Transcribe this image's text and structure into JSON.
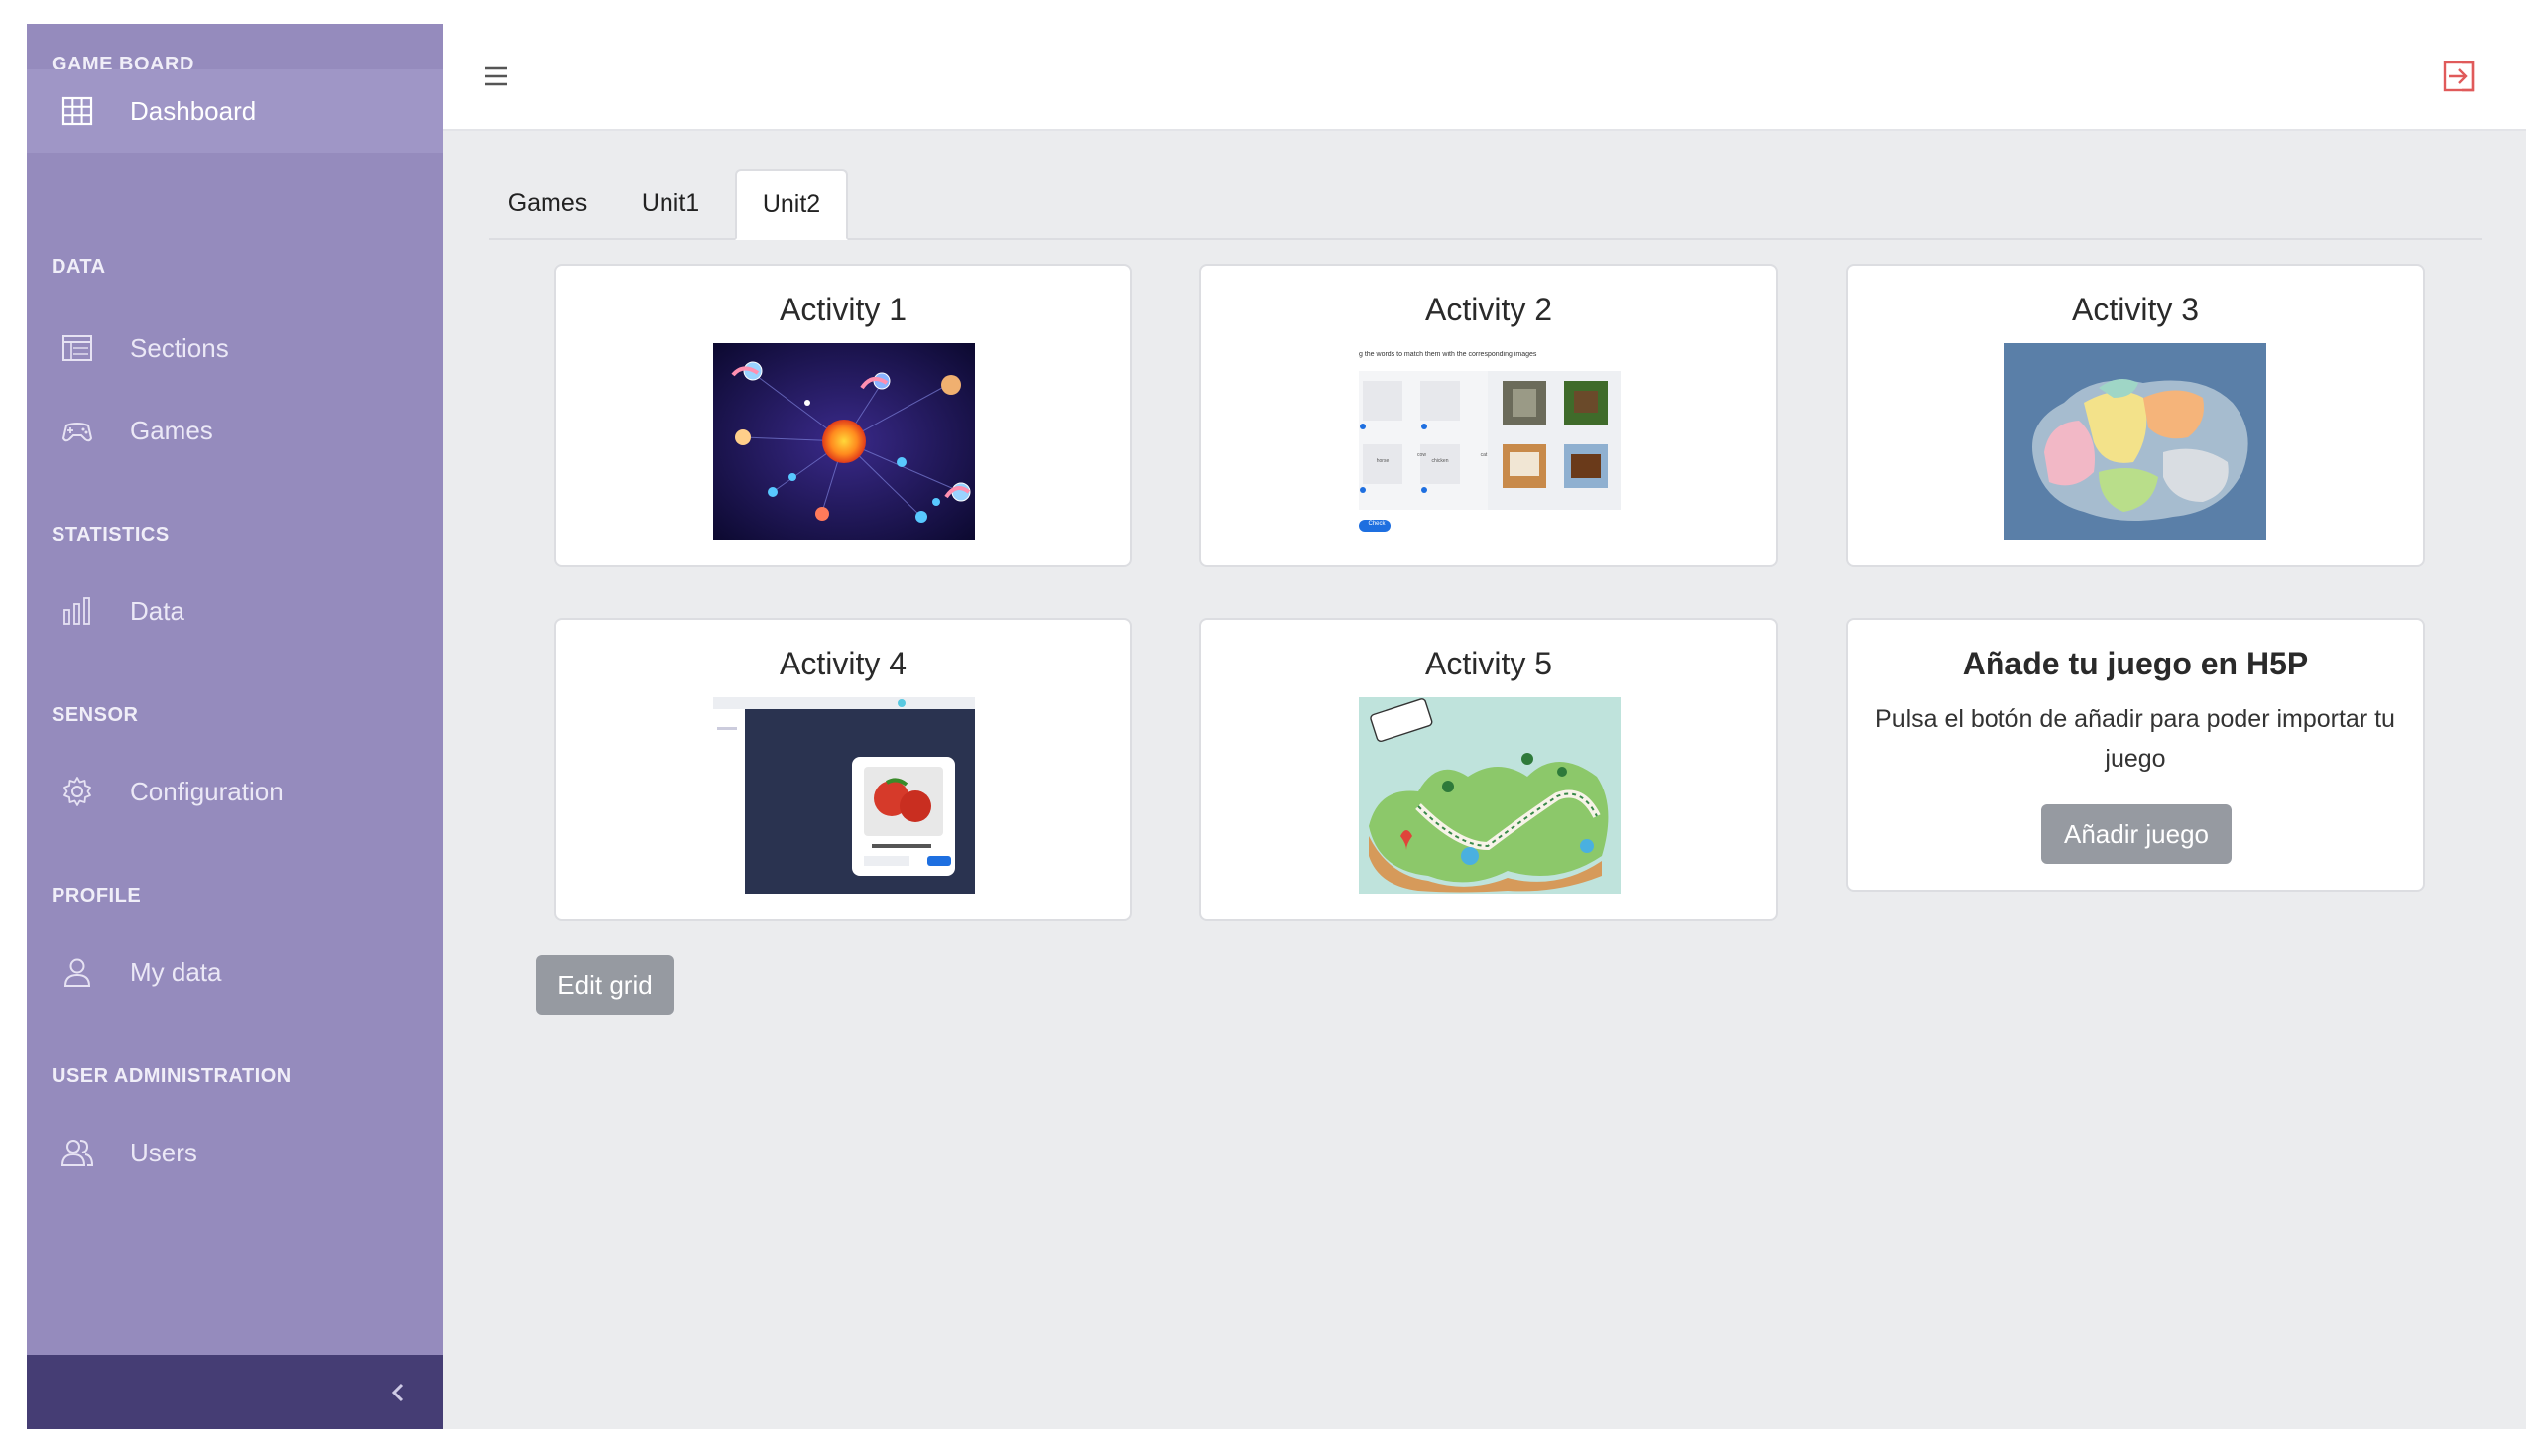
{
  "sidebar": {
    "sections": [
      {
        "title": "GAME BOARD",
        "items": [
          {
            "label": "Dashboard",
            "icon": "grid-icon",
            "active": true
          }
        ]
      },
      {
        "title": "DATA",
        "items": [
          {
            "label": "Sections",
            "icon": "table-icon"
          },
          {
            "label": "Games",
            "icon": "gamepad-icon"
          }
        ]
      },
      {
        "title": "STATISTICS",
        "items": [
          {
            "label": "Data",
            "icon": "bar-chart-icon"
          }
        ]
      },
      {
        "title": "SENSOR",
        "items": [
          {
            "label": "Configuration",
            "icon": "gear-icon"
          }
        ]
      },
      {
        "title": "PROFILE",
        "items": [
          {
            "label": "My data",
            "icon": "user-icon"
          }
        ]
      },
      {
        "title": "USER ADMINISTRATION",
        "items": [
          {
            "label": "Users",
            "icon": "users-icon"
          }
        ]
      }
    ],
    "collapse_icon": "chevron-left-icon"
  },
  "header": {
    "menu_icon": "hamburger-icon",
    "logout_icon": "logout-icon"
  },
  "tabs": [
    {
      "label": "Games",
      "active": false
    },
    {
      "label": "Unit1",
      "active": false
    },
    {
      "label": "Unit2",
      "active": true
    }
  ],
  "activities": [
    {
      "title": "Activity 1"
    },
    {
      "title": "Activity 2",
      "thumb_text": "g the words to match them with the corresponding images",
      "words": [
        "cow",
        "cat",
        "horse",
        "chicken"
      ],
      "check_label": "Check"
    },
    {
      "title": "Activity 3"
    },
    {
      "title": "Activity 4"
    },
    {
      "title": "Activity 5"
    }
  ],
  "add_card": {
    "title": "Añade tu juego en H5P",
    "description": "Pulsa el botón de añadir para poder importar tu juego",
    "button_label": "Añadir juego"
  },
  "edit_grid_label": "Edit grid",
  "colors": {
    "sidebar": "#958bbd",
    "sidebar_active": "#9f96c6",
    "sidebar_footer": "#453d74",
    "main_bg": "#ebecee",
    "logout": "#e05a5a"
  }
}
